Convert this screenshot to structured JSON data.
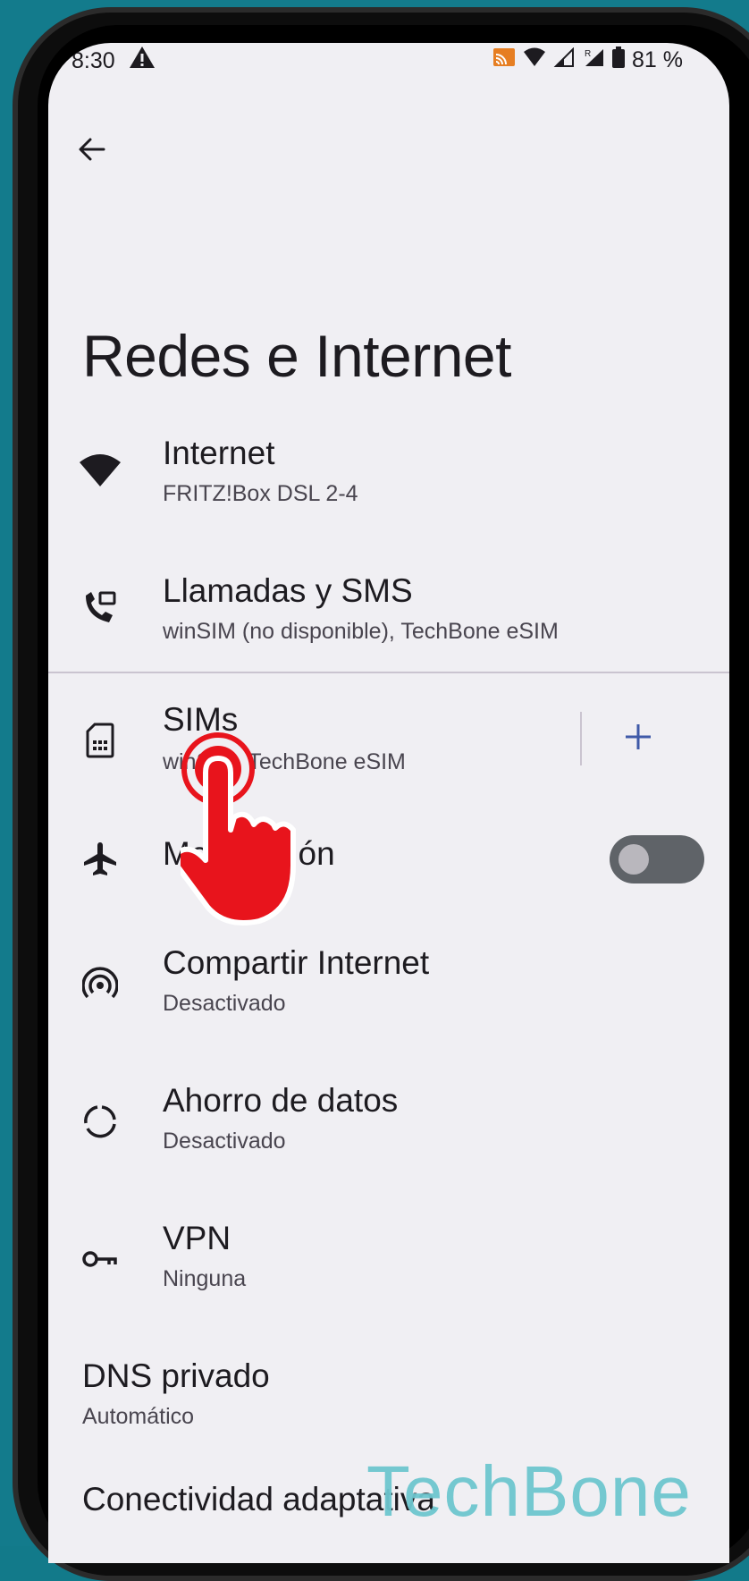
{
  "status_bar": {
    "time": "8:30",
    "battery": "81 %",
    "icons": [
      "warning-icon",
      "cast-icon",
      "wifi-icon",
      "signal-icon",
      "roaming-signal-icon",
      "battery-icon"
    ]
  },
  "page": {
    "title": "Redes e Internet"
  },
  "items": [
    {
      "title": "Internet",
      "subtitle": "FRITZ!Box DSL 2-4",
      "icon": "wifi-icon"
    },
    {
      "title": "Llamadas y SMS",
      "subtitle": "winSIM (no disponible), TechBone eSIM",
      "icon": "call-sms-icon"
    },
    {
      "title": "SIMs",
      "subtitle": "winSIM, TechBone eSIM",
      "icon": "sim-card-icon"
    },
    {
      "title": "Modo Avión",
      "subtitle": "",
      "icon": "airplane-icon",
      "toggle": false
    },
    {
      "title": "Compartir Internet",
      "subtitle": "Desactivado",
      "icon": "hotspot-icon"
    },
    {
      "title": "Ahorro de datos",
      "subtitle": "Desactivado",
      "icon": "data-saver-icon"
    },
    {
      "title": "VPN",
      "subtitle": "Ninguna",
      "icon": "vpn-key-icon"
    },
    {
      "title": "DNS privado",
      "subtitle": "Automático",
      "icon": ""
    },
    {
      "title": "Conectividad adaptativa",
      "subtitle": "",
      "icon": ""
    }
  ],
  "watermark": "TechBone",
  "colors": {
    "background": "#f0eff3",
    "accent": "#3f5aa8",
    "touch_indicator": "#e8141c",
    "frame_bg": "#137b8c"
  }
}
